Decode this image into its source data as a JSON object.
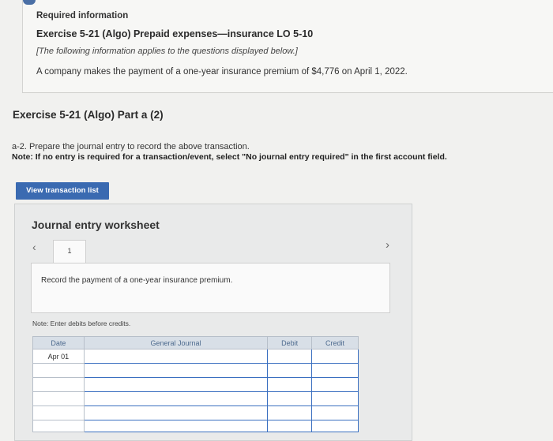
{
  "info": {
    "heading": "Required information",
    "title": "Exercise 5-21 (Algo) Prepaid expenses—insurance LO 5-10",
    "italic_note": "[The following information applies to the questions displayed below.]",
    "body": "A company makes the payment of a one-year insurance premium of $4,776 on April 1, 2022."
  },
  "part": {
    "title": "Exercise 5-21 (Algo) Part a (2)",
    "question": "a-2. Prepare the journal entry to record the above transaction.",
    "note": "Note: If no entry is required for a transaction/event, select \"No journal entry required\" in the first account field."
  },
  "buttons": {
    "view_transaction_list": "View transaction list"
  },
  "worksheet": {
    "title": "Journal entry worksheet",
    "prev_icon": "‹",
    "next_icon": "›",
    "tab_number": "1",
    "description": "Record the payment of a one-year insurance premium.",
    "note": "Note: Enter debits before credits.",
    "table": {
      "headers": [
        "Date",
        "General Journal",
        "Debit",
        "Credit"
      ],
      "rows": [
        {
          "date": "Apr 01",
          "account": "",
          "debit": "",
          "credit": ""
        },
        {
          "date": "",
          "account": "",
          "debit": "",
          "credit": ""
        },
        {
          "date": "",
          "account": "",
          "debit": "",
          "credit": ""
        },
        {
          "date": "",
          "account": "",
          "debit": "",
          "credit": ""
        },
        {
          "date": "",
          "account": "",
          "debit": "",
          "credit": ""
        },
        {
          "date": "",
          "account": "",
          "debit": "",
          "credit": ""
        }
      ]
    }
  }
}
